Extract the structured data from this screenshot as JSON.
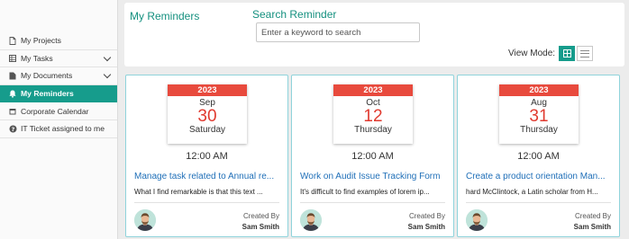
{
  "sidebar": {
    "items": [
      {
        "label": "My Projects",
        "icon": "file-icon"
      },
      {
        "label": "My Tasks",
        "icon": "task-list-icon"
      },
      {
        "label": "My Documents",
        "icon": "document-icon"
      },
      {
        "label": "My Reminders",
        "icon": "bell-icon"
      },
      {
        "label": "Corporate Calendar",
        "icon": "calendar-icon"
      },
      {
        "label": "IT Ticket assigned to me",
        "icon": "question-circle-icon"
      }
    ]
  },
  "header": {
    "title": "My Reminders",
    "search_label": "Search Reminder",
    "search_placeholder": "Enter a keyword to search",
    "search_value": "",
    "view_mode_label": "View Mode:",
    "view_mode_selected": "grid"
  },
  "cards": [
    {
      "year": "2023",
      "month": "Sep",
      "day": "30",
      "weekday": "Saturday",
      "time": "12:00 AM",
      "title": "Manage task related to Annual re...",
      "description": "What I find remarkable is that this text ...",
      "created_by_label": "Created By",
      "creator": "Sam Smith"
    },
    {
      "year": "2023",
      "month": "Oct",
      "day": "12",
      "weekday": "Thursday",
      "time": "12:00 AM",
      "title": "Work on Audit Issue Tracking Form",
      "description": "It's difficult to find examples of lorem ip...",
      "created_by_label": "Created By",
      "creator": "Sam Smith"
    },
    {
      "year": "2023",
      "month": "Aug",
      "day": "31",
      "weekday": "Thursday",
      "time": "12:00 AM",
      "title": "Create a product orientation Man...",
      "description": "hard McClintock, a Latin scholar from H...",
      "created_by_label": "Created By",
      "creator": "Sam Smith"
    }
  ],
  "colors": {
    "accent": "#169c8c",
    "calendar_red": "#e84a3d",
    "link_blue": "#1f6fb8",
    "card_border": "#8fd3db"
  }
}
